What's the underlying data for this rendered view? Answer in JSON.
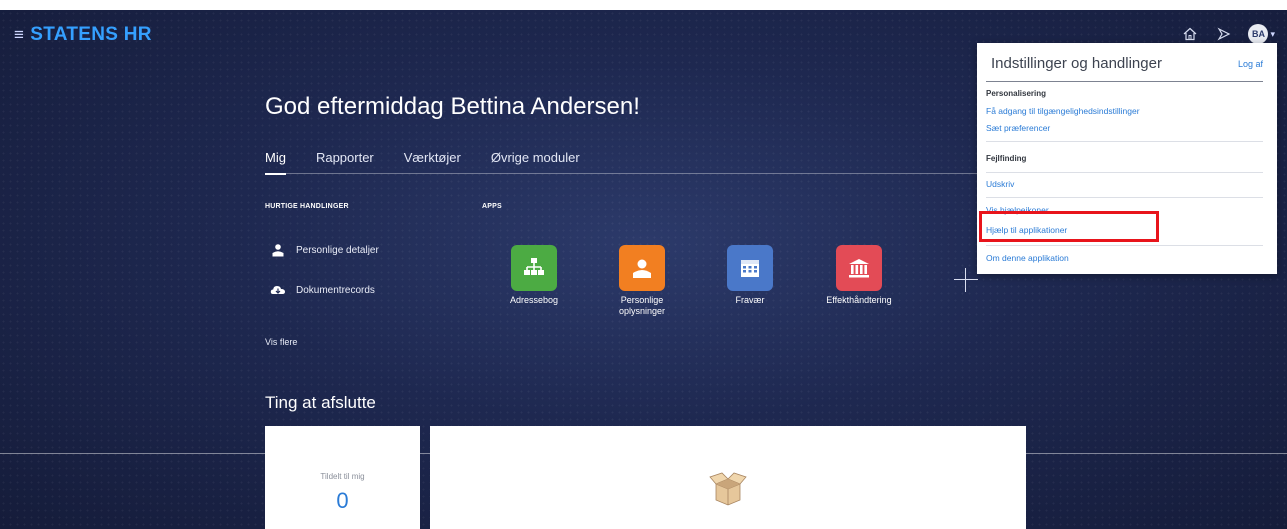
{
  "header": {
    "brand": "STATENS HR",
    "hamburger_icon": "hamburger-icon",
    "icons": [
      "home-icon",
      "navigator-icon"
    ],
    "avatar_initials": "BA"
  },
  "main": {
    "greeting": "God eftermiddag Bettina Andersen!",
    "tabs": [
      {
        "label": "Mig",
        "active": true
      },
      {
        "label": "Rapporter"
      },
      {
        "label": "Værktøjer"
      },
      {
        "label": "Øvrige moduler"
      }
    ],
    "quick_actions": {
      "title": "HURTIGE HANDLINGER",
      "items": [
        {
          "label": "Personlige detaljer",
          "icon": "person-icon"
        },
        {
          "label": "Dokumentrecords",
          "icon": "document-cloud-icon"
        }
      ],
      "more": "Vis flere"
    },
    "apps": {
      "title": "APPS",
      "items": [
        {
          "label": "Adressebog",
          "icon": "org-chart-icon",
          "color": "#4cab43"
        },
        {
          "label": "Personlige oplysninger",
          "icon": "person-card-icon",
          "color": "#f27f21"
        },
        {
          "label": "Fravær",
          "icon": "calendar-icon",
          "color": "#4a78c9"
        },
        {
          "label": "Effekthåndtering",
          "icon": "bank-icon",
          "color": "#e34b56"
        }
      ]
    },
    "todo": {
      "title": "Ting at afslutte",
      "assigned_label": "Tildelt til mig",
      "assigned_count": "0"
    }
  },
  "settings_panel": {
    "title": "Indstillinger og handlinger",
    "logout": "Log af",
    "sections": [
      {
        "title": "Personalisering",
        "links": [
          "Få adgang til tilgængelighedsindstillinger",
          "Sæt præferencer"
        ]
      },
      {
        "title": "Fejlfinding",
        "links": [
          "Udskriv",
          "Vis hjælpeikoner",
          "Hjælp til applikationer",
          "Om denne applikation"
        ]
      }
    ],
    "highlight_color": "#e8141b"
  }
}
